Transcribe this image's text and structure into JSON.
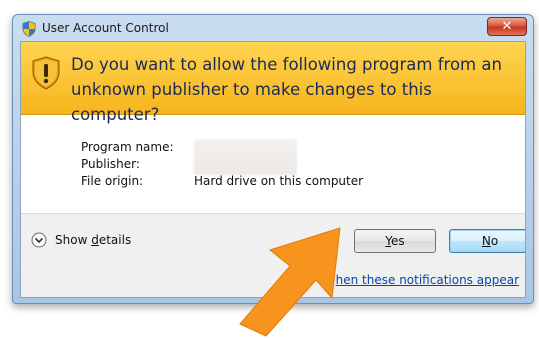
{
  "window": {
    "title": "User Account Control",
    "close_glyph": "✕"
  },
  "banner": {
    "question": "Do you want to allow the following program from an unknown publisher to make changes to this computer?"
  },
  "info": {
    "program_name_label": "Program name:",
    "publisher_label": "Publisher:",
    "file_origin_label": "File origin:",
    "file_origin_value": "Hard drive on this computer"
  },
  "footer": {
    "show_details": {
      "prefix": "Show ",
      "mnemonic": "d",
      "suffix": "etails"
    },
    "yes_button": {
      "mnemonic": "Y",
      "suffix": "es"
    },
    "no_button": {
      "mnemonic": "N",
      "suffix": "o"
    },
    "notifications_link": "hen these notifications appear"
  },
  "colors": {
    "banner": "#f6b51d",
    "title_bar": "#b9d1ea",
    "link": "#0645ad",
    "pointer": "#f7941d"
  },
  "icons": {
    "title": "uac-shield-icon",
    "banner": "warning-shield-icon",
    "details": "chevron-down-circle-icon",
    "pointer": "orange-pointer-arrow"
  }
}
